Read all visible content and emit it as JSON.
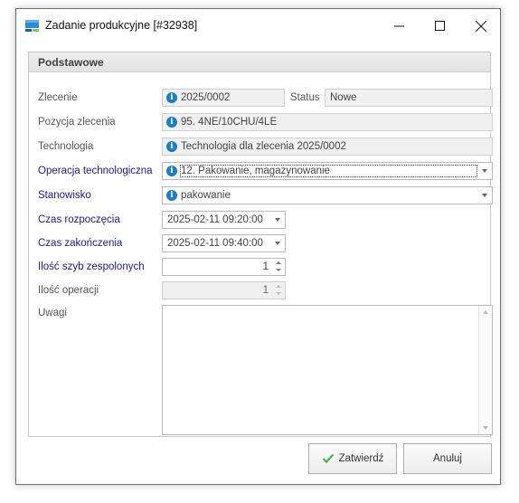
{
  "window": {
    "title": "Zadanie produkcyjne [#32938]"
  },
  "group": {
    "title": "Podstawowe"
  },
  "fields": {
    "zlecenie": {
      "label": "Zlecenie",
      "value": "2025/0002"
    },
    "status": {
      "label": "Status",
      "value": "Nowe"
    },
    "pozycja": {
      "label": "Pozycja zlecenia",
      "value": "95. 4NE/10CHU/4LE"
    },
    "technologia": {
      "label": "Technologia",
      "value": "Technologia dla zlecenia 2025/0002"
    },
    "operacja": {
      "label": "Operacja technologiczna",
      "value": "12. Pakowanie, magazynowanie"
    },
    "stanowisko": {
      "label": "Stanowisko",
      "value": "pakowanie"
    },
    "czas_rozpoczecia": {
      "label": "Czas rozpoczęcia",
      "value": "2025-02-11 09:20:00"
    },
    "czas_zakonczenia": {
      "label": "Czas zakończenia",
      "value": "2025-02-11 09:40:00"
    },
    "ilosc_szyb": {
      "label": "Ilość szyb zespolonych",
      "value": "1"
    },
    "ilosc_operacji": {
      "label": "Ilość operacji",
      "value": "1"
    },
    "uwagi": {
      "label": "Uwagi",
      "value": ""
    }
  },
  "buttons": {
    "confirm": "Zatwierdź",
    "cancel": "Anuluj"
  },
  "icons": {
    "info": "info-icon",
    "check": "check-icon"
  },
  "colors": {
    "required_label": "#1a1a8c",
    "info_icon": "#1e7bc6",
    "check_icon": "#4caf50"
  }
}
